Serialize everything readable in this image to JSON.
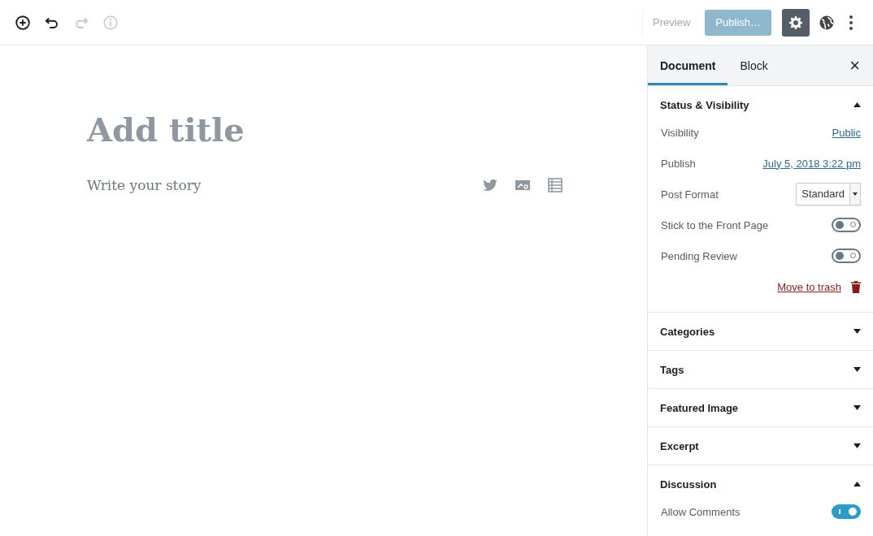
{
  "toolbar": {
    "tools": [
      {
        "kind": "add",
        "disabled": false
      },
      {
        "kind": "undo",
        "disabled": false
      },
      {
        "kind": "redo",
        "disabled": true
      },
      {
        "kind": "info",
        "disabled": true
      }
    ],
    "preview": {
      "label": "Preview",
      "disabled": true
    },
    "publish": {
      "label": "Publish…",
      "disabled": true
    },
    "settings": {
      "selected": true
    }
  },
  "editor": {
    "title_placeholder": "Add title",
    "body_placeholder": "Write your story"
  },
  "sidebar": {
    "tabs": [
      {
        "label": "Document",
        "selected": true
      },
      {
        "label": "Block",
        "selected": false
      }
    ],
    "close": "×",
    "panels": [
      {
        "title": "Status & Visibility",
        "expanded": true,
        "rows": [
          {
            "kind": "link",
            "label": "Visibility",
            "value": "Public"
          },
          {
            "kind": "link",
            "label": "Publish",
            "value": "July 5, 2018 3:22 pm"
          },
          {
            "kind": "select",
            "label": "Post Format",
            "value": "Standard"
          },
          {
            "kind": "toggle",
            "label": "Stick to the Front Page",
            "on": false
          },
          {
            "kind": "toggle",
            "label": "Pending Review",
            "on": false
          },
          {
            "kind": "trash",
            "label": "Move to trash"
          }
        ]
      },
      {
        "title": "Categories",
        "expanded": false
      },
      {
        "title": "Tags",
        "expanded": false
      },
      {
        "title": "Featured Image",
        "expanded": false
      },
      {
        "title": "Excerpt",
        "expanded": false
      },
      {
        "title": "Discussion",
        "expanded": true,
        "rows": [
          {
            "kind": "toggle",
            "label": "Allow Comments",
            "on": true
          }
        ]
      }
    ]
  }
}
